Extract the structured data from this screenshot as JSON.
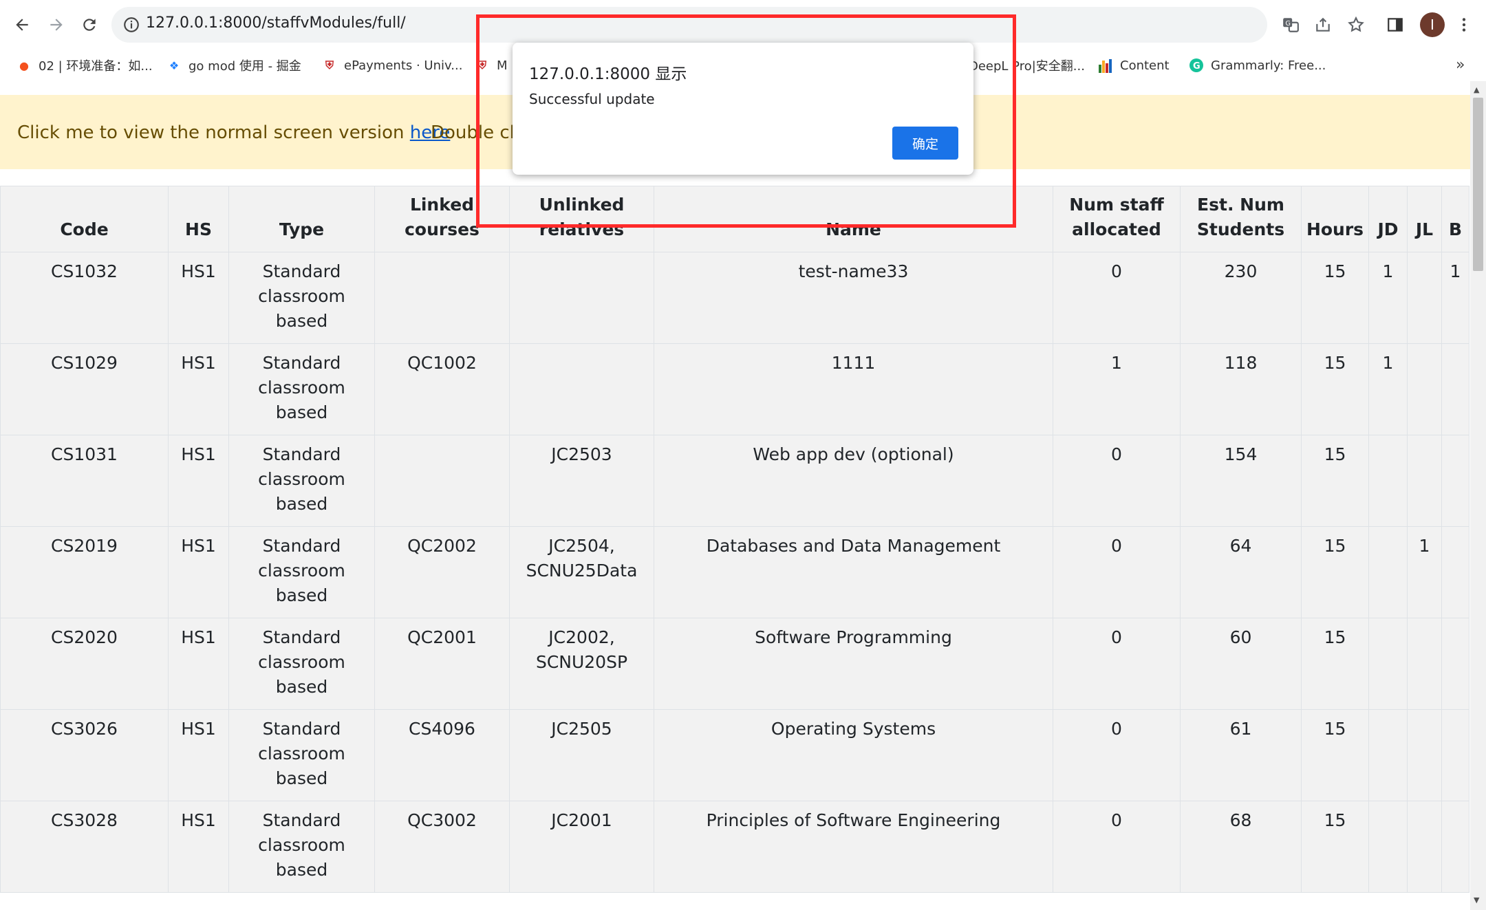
{
  "browser": {
    "url": "127.0.0.1:8000/staffvModules/full/",
    "bookmarks": [
      {
        "label": "02 | 环境准备：如...",
        "icon": "pin-icon"
      },
      {
        "label": "go mod 使用 - 掘金",
        "icon": "juejin-icon"
      },
      {
        "label": "ePayments · Univ...",
        "icon": "shield-icon"
      },
      {
        "label": "M",
        "icon": "bookmark-icon"
      },
      {
        "label": "DeepL Pro|安全翻...",
        "icon": "deepl-icon"
      },
      {
        "label": "Content",
        "icon": "bar-chart-icon"
      },
      {
        "label": "Grammarly: Free...",
        "icon": "grammarly-icon"
      }
    ],
    "avatar_letter": "I"
  },
  "banner": {
    "text_prefix": "Click me to view the normal screen version ",
    "link": "here",
    "text2": "Double cli"
  },
  "table": {
    "headers": [
      {
        "line1": "",
        "line2": "Code"
      },
      {
        "line1": "",
        "line2": "HS"
      },
      {
        "line1": "",
        "line2": "Type"
      },
      {
        "line1": "Linked",
        "line2": "courses"
      },
      {
        "line1": "Unlinked",
        "line2": "relatives"
      },
      {
        "line1": "",
        "line2": "Name"
      },
      {
        "line1": "Num staff",
        "line2": "allocated"
      },
      {
        "line1": "Est. Num",
        "line2": "Students"
      },
      {
        "line1": "",
        "line2": "Hours"
      },
      {
        "line1": "",
        "line2": "JD"
      },
      {
        "line1": "",
        "line2": "JL"
      },
      {
        "line1": "",
        "line2": "B"
      }
    ],
    "rows": [
      {
        "code": "CS1032",
        "hs": "HS1",
        "type": [
          "Standard",
          "classroom",
          "based"
        ],
        "linked": "",
        "unlinked": [
          "",
          ""
        ],
        "name": "test-name33",
        "staff": "0",
        "students": "230",
        "hours": "15",
        "jd": "1",
        "jl": "",
        "b": "1"
      },
      {
        "code": "CS1029",
        "hs": "HS1",
        "type": [
          "Standard",
          "classroom",
          "based"
        ],
        "linked": "QC1002",
        "unlinked": [
          "",
          ""
        ],
        "name": "1111",
        "staff": "1",
        "students": "118",
        "hours": "15",
        "jd": "1",
        "jl": "",
        "b": ""
      },
      {
        "code": "CS1031",
        "hs": "HS1",
        "type": [
          "Standard",
          "classroom",
          "based"
        ],
        "linked": "",
        "unlinked": [
          "JC2503",
          ""
        ],
        "name": "Web app dev (optional)",
        "staff": "0",
        "students": "154",
        "hours": "15",
        "jd": "",
        "jl": "",
        "b": ""
      },
      {
        "code": "CS2019",
        "hs": "HS1",
        "type": [
          "Standard",
          "classroom",
          "based"
        ],
        "linked": "QC2002",
        "unlinked": [
          "JC2504,",
          "SCNU25Data"
        ],
        "name": "Databases and Data Management",
        "staff": "0",
        "students": "64",
        "hours": "15",
        "jd": "",
        "jl": "1",
        "b": ""
      },
      {
        "code": "CS2020",
        "hs": "HS1",
        "type": [
          "Standard",
          "classroom",
          "based"
        ],
        "linked": "QC2001",
        "unlinked": [
          "JC2002,",
          "SCNU20SP"
        ],
        "name": "Software Programming",
        "staff": "0",
        "students": "60",
        "hours": "15",
        "jd": "",
        "jl": "",
        "b": ""
      },
      {
        "code": "CS3026",
        "hs": "HS1",
        "type": [
          "Standard",
          "classroom",
          "based"
        ],
        "linked": "CS4096",
        "unlinked": [
          "JC2505",
          ""
        ],
        "name": "Operating Systems",
        "staff": "0",
        "students": "61",
        "hours": "15",
        "jd": "",
        "jl": "",
        "b": ""
      },
      {
        "code": "CS3028",
        "hs": "HS1",
        "type": [
          "Standard",
          "classroom",
          "based"
        ],
        "linked": "QC3002",
        "unlinked": [
          "JC2001",
          ""
        ],
        "name": "Principles of Software Engineering",
        "staff": "0",
        "students": "68",
        "hours": "15",
        "jd": "",
        "jl": "",
        "b": ""
      }
    ]
  },
  "dialog": {
    "title": "127.0.0.1:8000 显示",
    "message": "Successful update",
    "ok_label": "确定"
  }
}
